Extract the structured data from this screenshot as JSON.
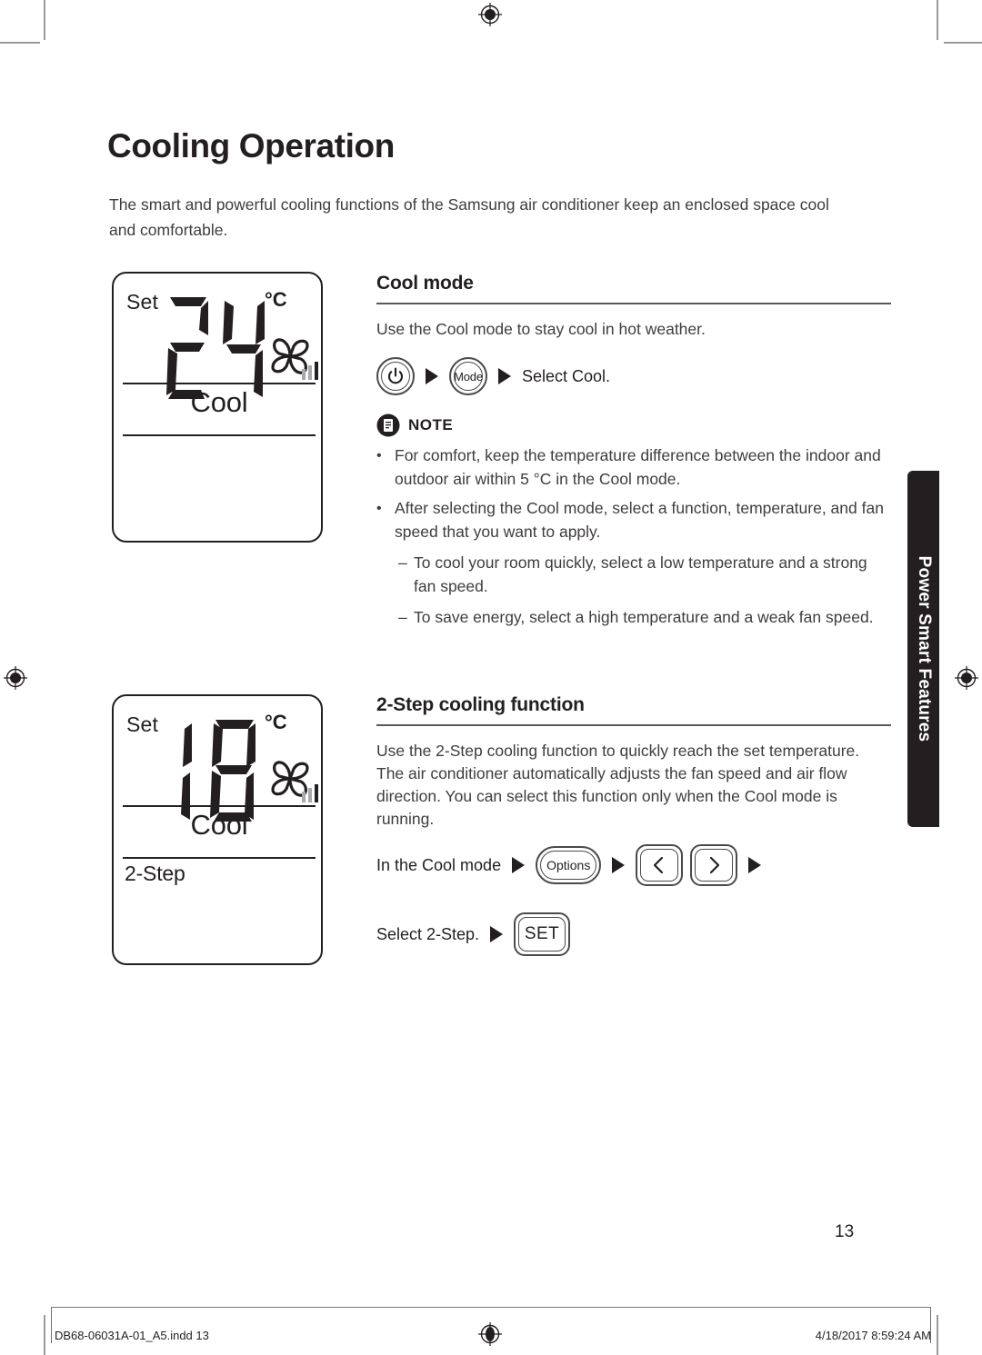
{
  "document": {
    "page_title": "Cooling Operation",
    "intro": "The smart and powerful cooling functions of the Samsung air conditioner keep an enclosed space cool and comfortable.",
    "page_number": "13",
    "side_tab_label": "Power Smart Features"
  },
  "lcd_panels": [
    {
      "set_label": "Set",
      "temperature": "24",
      "unit": "°C",
      "mode_name": "Cool",
      "function_name": "",
      "fan_icon": "fan-pinwheel-icon",
      "fan_bars": "fan-speed-bars-icon"
    },
    {
      "set_label": "Set",
      "temperature": "18",
      "unit": "°C",
      "mode_name": "Cool",
      "function_name": "2-Step",
      "fan_icon": "fan-pinwheel-icon",
      "fan_bars": "fan-speed-bars-icon"
    }
  ],
  "cool_mode": {
    "heading": "Cool mode",
    "description": "Use the Cool mode to stay cool in hot weather.",
    "steps": {
      "power_button": "power-icon",
      "mode_button": "Mode",
      "result_text": "Select Cool."
    },
    "note": {
      "label": "NOTE",
      "icon": "note-document-icon",
      "bullets": [
        {
          "level": 1,
          "marker": "•",
          "text": "For comfort, keep the temperature difference between the indoor and outdoor air within 5 °C in the Cool mode."
        },
        {
          "level": 1,
          "marker": "•",
          "text": "After selecting the Cool mode, select a function, temperature, and fan speed that you want to apply."
        },
        {
          "level": 2,
          "marker": "–",
          "text": "To cool your room quickly, select a low temperature and a strong fan speed."
        },
        {
          "level": 2,
          "marker": "–",
          "text": "To save energy, select a high temperature and a weak fan speed."
        }
      ]
    }
  },
  "two_step": {
    "heading": "2-Step cooling function",
    "description": "Use the 2-Step cooling function to quickly reach the set temperature. The air conditioner automatically adjusts the fan speed and air flow direction. You can select this function only when the Cool mode is running.",
    "row1": {
      "lead_text": "In the Cool mode",
      "options_button": "Options",
      "left_button": "left-chevron-icon",
      "right_button": "right-chevron-icon"
    },
    "row2": {
      "lead_text": "Select 2-Step.",
      "set_button": "SET"
    }
  },
  "footer": {
    "file_name": "DB68-06031A-01_A5.indd   13",
    "timestamp": "4/18/2017   8:59:24 AM"
  },
  "colors": {
    "ink": "#231f20",
    "body": "#403c3d",
    "rule": "#58595b",
    "tab_bg": "#231f20",
    "crop": "#9a9a9a"
  }
}
